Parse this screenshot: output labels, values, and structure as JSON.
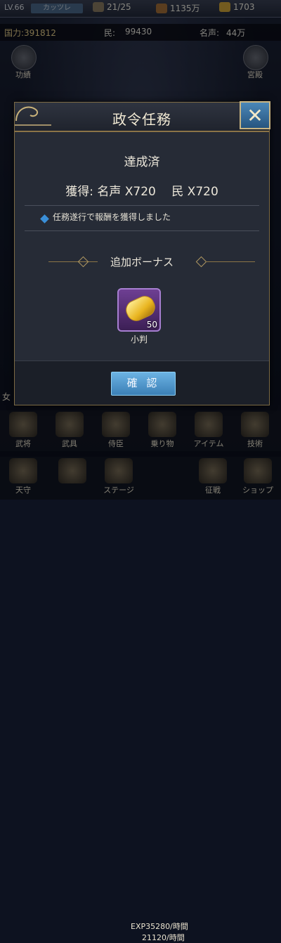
{
  "hud": {
    "level": "LV.66",
    "name": "カッツレ",
    "stamina": "21/25",
    "food": "1135万",
    "gold": "1703",
    "power_label": "国力:391812",
    "people_label": "民:",
    "people_value": "99430",
    "fame_label": "名声:",
    "fame_value": "44万",
    "left_icon_label": "功績",
    "right_icon_label": "宮殿",
    "left_edge_char": "女"
  },
  "dialog": {
    "title": "政令任務",
    "status": "達成済",
    "reward_line": "獲得: 名声 X720　 民 X720",
    "note": "任務遂行で報酬を獲得しました",
    "bonus_title": "追加ボーナス",
    "item": {
      "name": "小判",
      "count": "50",
      "icon": "koban-coin-icon"
    },
    "confirm_label": "確 認",
    "close_icon": "close-icon"
  },
  "menu": {
    "row1": [
      {
        "label": "武将",
        "icon": "general-icon"
      },
      {
        "label": "武具",
        "icon": "armor-icon"
      },
      {
        "label": "侍臣",
        "icon": "retainer-icon"
      },
      {
        "label": "乗り物",
        "icon": "horse-icon"
      },
      {
        "label": "アイテム",
        "icon": "item-bag-icon"
      },
      {
        "label": "技術",
        "icon": "tech-icon"
      }
    ],
    "row2": [
      {
        "label": "天守",
        "icon": "castle-icon"
      },
      {
        "label": "",
        "icon": "shop-icon"
      },
      {
        "label": "ステージ",
        "icon": "stage-icon"
      },
      {
        "label": "",
        "icon": "battle-icon"
      },
      {
        "label": "ショップ",
        "icon": "shop-icon"
      }
    ],
    "exp1": "EXP35280/時間",
    "exp2": "21120/時間",
    "battle_label": "征戦"
  }
}
